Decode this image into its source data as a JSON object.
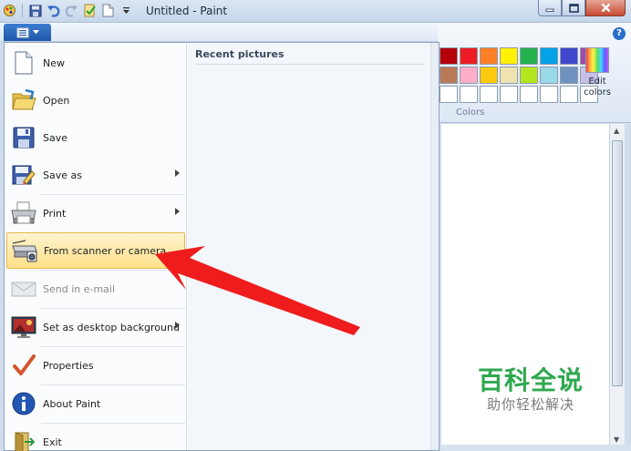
{
  "window": {
    "title": "Untitled - Paint"
  },
  "quick_access": [
    "paint-app-icon",
    "save-icon",
    "undo-icon",
    "redo-icon",
    "properties-icon",
    "new-icon",
    "dropdown-icon"
  ],
  "ribbon": {
    "colors_group_label": "Colors",
    "edit_colors_label_1": "Edit",
    "edit_colors_label_2": "colors",
    "palette_colors": [
      "#b5000c",
      "#ed1c24",
      "#ff7f27",
      "#fff200",
      "#22b14c",
      "#00a2e8",
      "#3f48cc",
      "#a349a4",
      "#b97a57",
      "#ffaec9",
      "#ffc90e",
      "#efe4b0",
      "#b5e61d",
      "#99d9ea",
      "#7092be",
      "#c8bfe7",
      "#ffffff",
      "#ffffff",
      "#ffffff",
      "#ffffff",
      "#ffffff",
      "#ffffff",
      "#ffffff",
      "#ffffff"
    ]
  },
  "app_menu": {
    "recent_header": "Recent pictures",
    "items": [
      {
        "label": "New",
        "icon": "new-document-icon",
        "submenu": false,
        "disabled": false,
        "highlighted": false
      },
      {
        "label": "Open",
        "icon": "open-folder-icon",
        "submenu": false,
        "disabled": false,
        "highlighted": false
      },
      {
        "label": "Save",
        "icon": "save-disk-icon",
        "submenu": false,
        "disabled": false,
        "highlighted": false
      },
      {
        "label": "Save as",
        "icon": "save-as-icon",
        "submenu": true,
        "disabled": false,
        "highlighted": false
      },
      {
        "label": "Print",
        "icon": "printer-icon",
        "submenu": true,
        "disabled": false,
        "highlighted": false
      },
      {
        "label": "From scanner or camera",
        "icon": "scanner-icon",
        "submenu": false,
        "disabled": false,
        "highlighted": true
      },
      {
        "label": "Send in e-mail",
        "icon": "email-icon",
        "submenu": false,
        "disabled": true,
        "highlighted": false
      },
      {
        "label": "Set as desktop background",
        "icon": "desktop-background-icon",
        "submenu": true,
        "disabled": false,
        "highlighted": false
      },
      {
        "label": "Properties",
        "icon": "checkmark-icon",
        "submenu": false,
        "disabled": false,
        "highlighted": false
      },
      {
        "label": "About Paint",
        "icon": "info-icon",
        "submenu": false,
        "disabled": false,
        "highlighted": false
      },
      {
        "label": "Exit",
        "icon": "exit-icon",
        "submenu": false,
        "disabled": false,
        "highlighted": false
      }
    ]
  },
  "annotation": {
    "arrow_color": "#ee1c1c"
  },
  "watermark": {
    "main": "百科全说",
    "sub": "助你轻松解决"
  }
}
